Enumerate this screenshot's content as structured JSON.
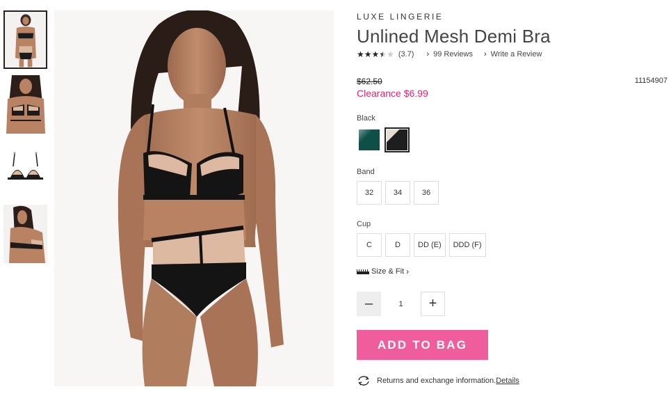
{
  "thumbnails": [
    {
      "name": "front-view",
      "active": true
    },
    {
      "name": "front-close",
      "active": false
    },
    {
      "name": "product-flat",
      "active": false
    },
    {
      "name": "back-view",
      "active": false
    }
  ],
  "product": {
    "brand": "LUXE LINGERIE",
    "title": "Unlined Mesh Demi Bra",
    "rating": 3.7,
    "rating_text": "(3.7)",
    "reviews_link": "99 Reviews",
    "write_review_link": "Write a Review",
    "original_price": "$62.50",
    "sku": "11154907",
    "clearance_price": "Clearance $6.99"
  },
  "color": {
    "label": "Black",
    "swatches": [
      {
        "name": "green",
        "color": "#0e5048",
        "selected": false
      },
      {
        "name": "black",
        "color": "#1e1e1e",
        "selected": true
      }
    ]
  },
  "band": {
    "label": "Band",
    "options": [
      "32",
      "34",
      "36"
    ]
  },
  "cup": {
    "label": "Cup",
    "options": [
      "C",
      "D",
      "DD (E)",
      "DDD (F)"
    ]
  },
  "size_fit": {
    "label": "Size & Fit"
  },
  "quantity": {
    "value": "1",
    "minus": "–",
    "plus": "+"
  },
  "cta": {
    "add_to_bag": "ADD TO BAG",
    "accent": "#ef5d9c"
  },
  "returns": {
    "text": "Returns and exchange information.",
    "link": "Details"
  },
  "icons": {
    "star": "★",
    "chevron": "›"
  }
}
